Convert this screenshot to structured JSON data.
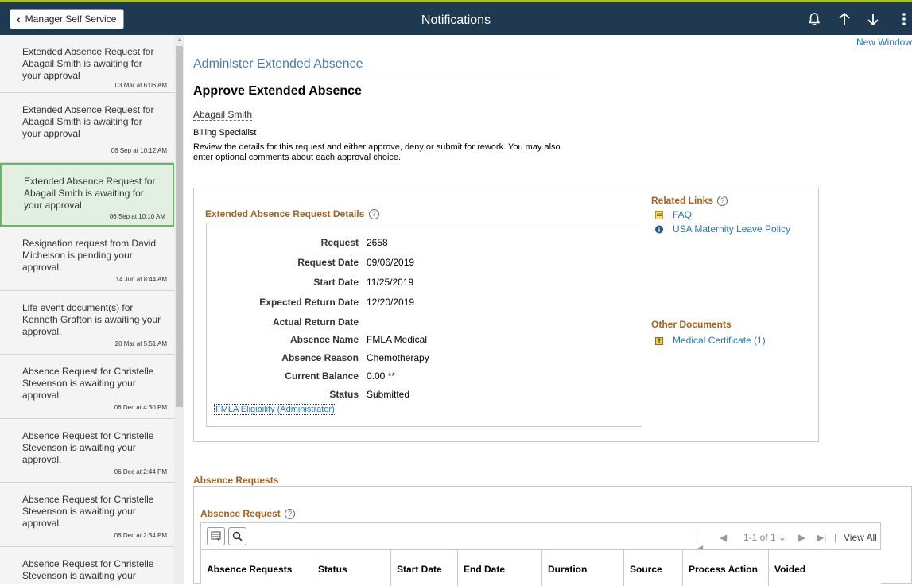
{
  "header": {
    "back_label": "Manager Self Service",
    "title": "Notifications"
  },
  "notifications": [
    {
      "text": "Extended Absence Request for Abagail Smith is awaiting for your approval",
      "time": "03 Mar at 6:06 AM"
    },
    {
      "text": "Extended Absence Request for Abagail Smith is awaiting for your approval",
      "time": "06 Sep at 10:12 AM"
    },
    {
      "text": "Extended Absence Request for Abagail Smith is awaiting for your approval",
      "time": "06 Sep at 10:10 AM"
    },
    {
      "text": "Resignation request from David Michelson is pending your approval.",
      "time": "14 Jun at 8:44 AM"
    },
    {
      "text": "Life event document(s) for Kenneth Grafton is awaiting your approval.",
      "time": "20 Mar at 5:51 AM"
    },
    {
      "text": "Absence Request for Christelle Stevenson is awaiting your approval.",
      "time": "06 Dec at 4:30 PM"
    },
    {
      "text": "Absence Request for Christelle Stevenson is awaiting your approval.",
      "time": "06 Dec at 2:44 PM"
    },
    {
      "text": "Absence Request for Christelle Stevenson is awaiting your approval.",
      "time": "06 Dec at 2:34 PM"
    },
    {
      "text": "Absence Request for Christelle Stevenson is awaiting your approval."
    }
  ],
  "main": {
    "new_window": "New Window",
    "breadcrumb_title": "Administer Extended Absence",
    "page_title": "Approve Extended Absence",
    "employee_name": "Abagail Smith",
    "employee_job": "Billing Specialist",
    "instructions": "Review the details for this request and either approve, deny or submit for rework. You may also enter optional comments about each approval choice."
  },
  "details": {
    "heading": "Extended Absence Request Details",
    "help": "?",
    "rows": [
      {
        "label": "Request",
        "value": "2658"
      },
      {
        "label": "Request Date",
        "value": "09/06/2019"
      },
      {
        "label": "Start Date",
        "value": "11/25/2019"
      },
      {
        "label": "Expected Return Date",
        "value": "12/20/2019"
      },
      {
        "label": "Actual Return Date",
        "value": ""
      },
      {
        "label": "Absence Name",
        "value": "FMLA Medical"
      },
      {
        "label": "Absence Reason",
        "value": "Chemotherapy"
      },
      {
        "label": "Current Balance",
        "value": "0.00 **"
      },
      {
        "label": "Status",
        "value": "Submitted"
      }
    ],
    "eligibility_link": "FMLA Eligibility (Administrator)"
  },
  "related": {
    "heading": "Related Links",
    "links": [
      "FAQ",
      "USA Maternity Leave Policy"
    ],
    "docs_heading": "Other Documents",
    "docs": [
      "Medical Certificate (1)"
    ]
  },
  "absence": {
    "section_heading": "Absence Requests",
    "grid_heading": "Absence Request",
    "pager": {
      "first": "|◀",
      "prev": "◀",
      "count": "1-1 of 1 ⌄",
      "next": "▶",
      "last": "▶|",
      "sep": "|",
      "view_all": "View All"
    },
    "columns": [
      "Absence Requests",
      "Status",
      "Start Date",
      "End Date",
      "Duration",
      "Source",
      "Process Action",
      "Voided"
    ]
  },
  "colors": {
    "header_bg": "#1f3951",
    "accent": "#a8c020",
    "section_heading": "#a6631f",
    "link": "#2a76b8",
    "selected_bg": "#e1f0e1",
    "selected_border": "#6ab56a"
  }
}
